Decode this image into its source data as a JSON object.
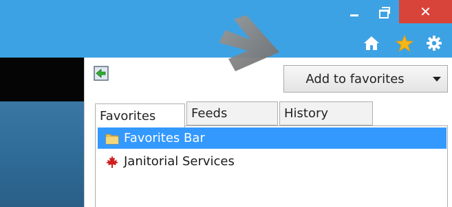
{
  "window": {
    "minimize_symbol": "–",
    "restore_symbol": "❐",
    "close_symbol": "✕",
    "accent": "#3da2e3",
    "close_color": "#d9443a"
  },
  "toolbar": {
    "icons": [
      "home-icon",
      "star-icon",
      "gear-icon"
    ],
    "star_color": "#f5b617"
  },
  "favorites_panel": {
    "add_button_label": "Add to favorites",
    "tabs": [
      {
        "label": "Favorites",
        "active": true
      },
      {
        "label": "Feeds",
        "active": false
      },
      {
        "label": "History",
        "active": false
      }
    ],
    "items": [
      {
        "label": "Favorites Bar",
        "icon": "folder-icon",
        "selected": true
      },
      {
        "label": "Janitorial Services",
        "icon": "maple-leaf-icon",
        "selected": false
      }
    ],
    "selection_color": "#3399ff"
  }
}
